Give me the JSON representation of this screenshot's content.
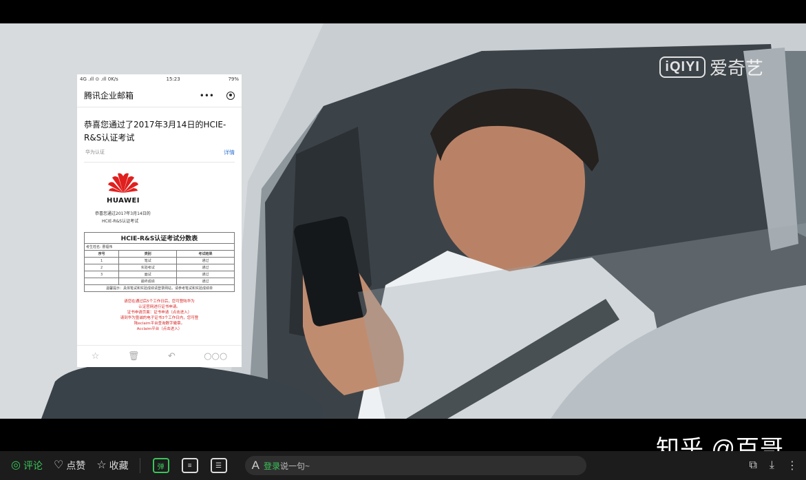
{
  "watermarks": {
    "iqiyi_logo": "iQIYI",
    "iqiyi_cn": "爱奇艺",
    "zhihu": "知乎 @百哥"
  },
  "phone": {
    "status_left": "4G .ıll ⊙ .ıll 0K/s",
    "status_time": "15:23",
    "status_right": "79%",
    "app_title": "腾讯企业邮箱",
    "header_dots": "•••",
    "subject": "恭喜您通过了2017年3月14日的HCIE-R&S认证考试",
    "sender": "华为认证",
    "detail_link": "详情",
    "brand": "HUAWEI",
    "congrats_line1": "恭喜您通过2017年3月14日的",
    "congrats_line2": "HCIE-R&S认证考试",
    "table_title": "HCIE-R&S认证考试分数表",
    "candidate_label": "考生姓名: 曹福伟",
    "columns": [
      "序号",
      "类别",
      "考试结果"
    ],
    "rows": [
      [
        "1",
        "笔试",
        "通过"
      ],
      [
        "2",
        "实验考试",
        "通过"
      ],
      [
        "3",
        "面试",
        "通过"
      ],
      [
        "",
        "最终成绩",
        "通过"
      ]
    ],
    "table_note": "温馨提示：具体笔试和实验成绩请登录网站，请参考笔试和实验成绩单",
    "red_lines": [
      "请您在通过后5个工作日后，您可登陆华为",
      "认证官网进行证书申请。",
      "证书申请页面：证书申请（点击进入）",
      "请到华为暨诚的电子证书3个工作日内，您可登",
      "陆eclaim平台查询数字徽章。",
      "Acclaim平台（点击进入）"
    ]
  },
  "toolbar": {
    "comment": "评论",
    "like": "点赞",
    "favorite": "收藏",
    "input_login": "登录",
    "input_placeholder": "说一句~"
  }
}
